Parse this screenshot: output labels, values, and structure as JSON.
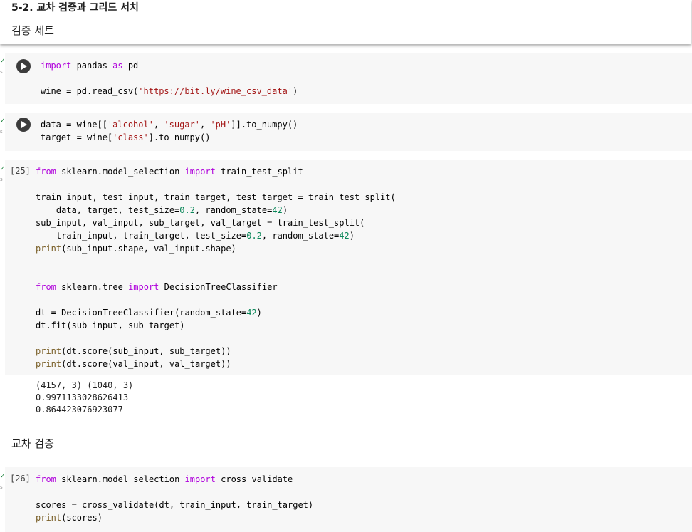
{
  "section": {
    "title": "5-2. 교차 검증과 그리드 서치",
    "subtitle": "검증 세트"
  },
  "cells": [
    {
      "exec_label": "",
      "lines": [
        [
          [
            "kw",
            "import"
          ],
          [
            "p",
            " pandas "
          ],
          [
            "kw",
            "as"
          ],
          [
            "p",
            " pd"
          ]
        ],
        [],
        [
          [
            "p",
            "wine = pd.read_csv("
          ],
          [
            "str",
            "'"
          ],
          [
            "url",
            "https://bit.ly/wine_csv_data"
          ],
          [
            "str",
            "'"
          ],
          [
            "p",
            ")"
          ]
        ]
      ]
    },
    {
      "exec_label": "",
      "lines": [
        [
          [
            "p",
            "data = wine[["
          ],
          [
            "str",
            "'alcohol'"
          ],
          [
            "p",
            ", "
          ],
          [
            "str",
            "'sugar'"
          ],
          [
            "p",
            ", "
          ],
          [
            "str",
            "'pH'"
          ],
          [
            "p",
            "]].to_numpy()"
          ]
        ],
        [
          [
            "p",
            "target = wine["
          ],
          [
            "str",
            "'class'"
          ],
          [
            "p",
            "].to_numpy()"
          ]
        ]
      ]
    },
    {
      "exec_label": "[25]",
      "lines": [
        [
          [
            "kw",
            "from"
          ],
          [
            "p",
            " sklearn.model_selection "
          ],
          [
            "kw",
            "import"
          ],
          [
            "p",
            " train_test_split"
          ]
        ],
        [],
        [
          [
            "p",
            "train_input, test_input, train_target, test_target = train_test_split("
          ]
        ],
        [
          [
            "p",
            "    data, target, test_size="
          ],
          [
            "num",
            "0.2"
          ],
          [
            "p",
            ", random_state="
          ],
          [
            "num",
            "42"
          ],
          [
            "p",
            ")"
          ]
        ],
        [
          [
            "p",
            "sub_input, val_input, sub_target, val_target = train_test_split("
          ]
        ],
        [
          [
            "p",
            "    train_input, train_target, test_size="
          ],
          [
            "num",
            "0.2"
          ],
          [
            "p",
            ", random_state="
          ],
          [
            "num",
            "42"
          ],
          [
            "p",
            ")"
          ]
        ],
        [
          [
            "fn",
            "print"
          ],
          [
            "p",
            "(sub_input.shape, val_input.shape)"
          ]
        ],
        [],
        [],
        [
          [
            "kw",
            "from"
          ],
          [
            "p",
            " sklearn.tree "
          ],
          [
            "kw",
            "import"
          ],
          [
            "p",
            " DecisionTreeClassifier"
          ]
        ],
        [],
        [
          [
            "p",
            "dt = DecisionTreeClassifier(random_state="
          ],
          [
            "num",
            "42"
          ],
          [
            "p",
            ")"
          ]
        ],
        [
          [
            "p",
            "dt.fit(sub_input, sub_target)"
          ]
        ],
        [],
        [
          [
            "fn",
            "print"
          ],
          [
            "p",
            "(dt.score(sub_input, sub_target))"
          ]
        ],
        [
          [
            "fn",
            "print"
          ],
          [
            "p",
            "(dt.score(val_input, val_target))"
          ]
        ]
      ],
      "output": "(4157, 3) (1040, 3)\n0.9971133028626413\n0.864423076923077"
    },
    {
      "exec_label": "[26]",
      "lines": [
        [
          [
            "kw",
            "from"
          ],
          [
            "p",
            " sklearn.model_selection "
          ],
          [
            "kw",
            "import"
          ],
          [
            "p",
            " cross_validate"
          ]
        ],
        [],
        [
          [
            "p",
            "scores = cross_validate(dt, train_input, train_target)"
          ]
        ],
        [
          [
            "fn",
            "print"
          ],
          [
            "p",
            "(scores)"
          ]
        ]
      ]
    }
  ],
  "markdown2": "교차 검증",
  "icons": {
    "run": "play-circle-icon",
    "status": "checkmark-icon"
  },
  "colors": {
    "keyword": "#af00db",
    "string": "#a31515",
    "number": "#098658",
    "function": "#795e26",
    "cell_bg": "#f7f7f7"
  }
}
